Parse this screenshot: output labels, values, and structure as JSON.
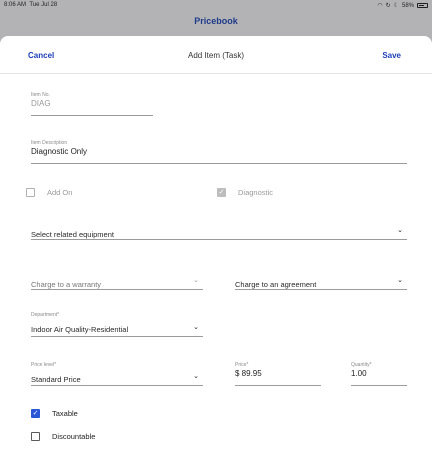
{
  "status_bar": {
    "time": "8:06 AM",
    "date": "Tue Jul 28",
    "battery": "58%"
  },
  "background_title": "Pricebook",
  "header": {
    "cancel_label": "Cancel",
    "title": "Add Item (Task)",
    "save_label": "Save"
  },
  "form": {
    "item_no": {
      "label": "Item No.",
      "value": "DIAG"
    },
    "item_description": {
      "label": "Item Description",
      "value": "Diagnostic Only"
    },
    "add_on": {
      "label": "Add On",
      "checked": false
    },
    "diagnostic": {
      "label": "Diagnostic",
      "checked": true
    },
    "related_equipment": {
      "placeholder": "Select related equipment"
    },
    "warranty": {
      "placeholder": "Charge to a warranty"
    },
    "agreement": {
      "placeholder": "Charge to an agreement"
    },
    "department": {
      "label": "Department*",
      "value": "Indoor Air Quality-Residential"
    },
    "price_level": {
      "label": "Price level*",
      "value": "Standard Price"
    },
    "price": {
      "label": "Price*",
      "value": "$ 89.95"
    },
    "quantity": {
      "label": "Quantity*",
      "value": "1.00"
    },
    "taxable": {
      "label": "Taxable",
      "checked": true
    },
    "discountable": {
      "label": "Discountable",
      "checked": false
    }
  },
  "colors": {
    "accent": "#1d3fbb",
    "checkbox_checked": "#2a56d8",
    "backdrop": "#b3b3b6"
  }
}
